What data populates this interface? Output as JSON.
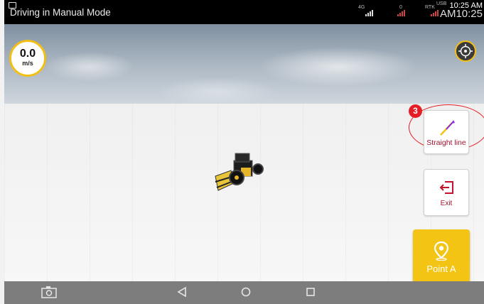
{
  "status_bar": {
    "title": "Driving in Manual Mode",
    "network_4g": "4G",
    "network_2": "0",
    "network_rtk": "RTK",
    "clock_small": "10:25 AM",
    "clock_big": "AM10:25",
    "signal_badge": "USB"
  },
  "speed": {
    "value": "0.0",
    "unit": "m/s"
  },
  "controls": {
    "straight_line_label": "Straight line",
    "straight_line_badge": "3",
    "exit_label": "Exit",
    "point_a_label": "Point A"
  },
  "colors": {
    "accent_yellow": "#f3c414",
    "label_red": "#a2132e",
    "badge_red": "#e31e24"
  },
  "icons": [
    "camera-icon",
    "back-icon",
    "home-icon",
    "recents-icon",
    "compass-icon",
    "straight-line-icon",
    "exit-icon",
    "location-pin-icon"
  ]
}
